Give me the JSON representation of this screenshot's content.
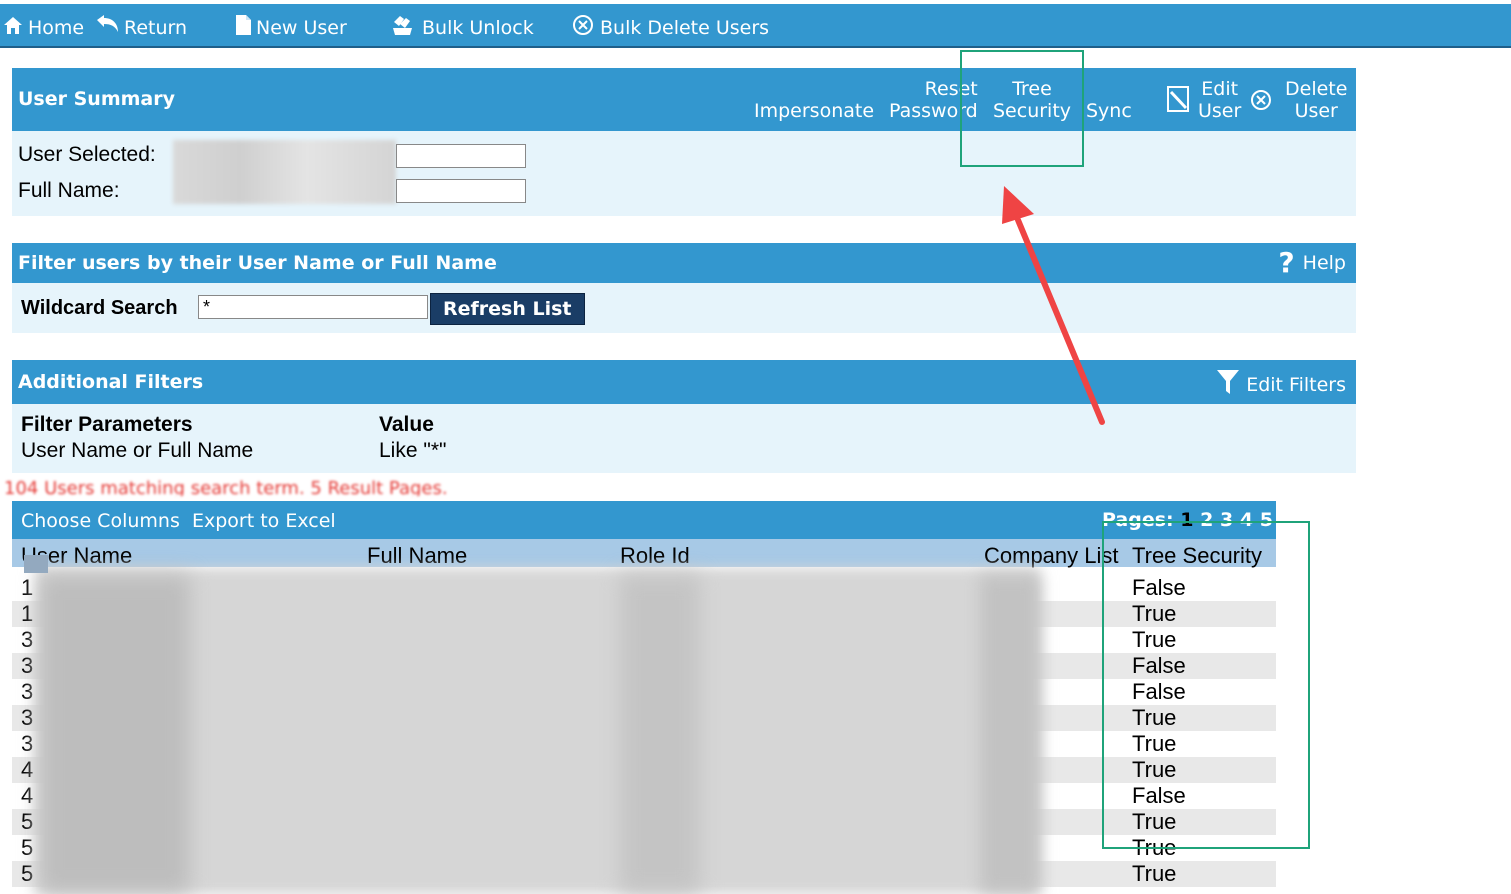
{
  "toolbar": {
    "home": "Home",
    "return": "Return",
    "new_user": "New User",
    "bulk_unlock": "Bulk Unlock",
    "bulk_delete": "Bulk Delete Users"
  },
  "user_summary": {
    "title": "User Summary",
    "actions": {
      "impersonate": "Impersonate",
      "reset_password_1": "Reset",
      "reset_password_2": "Password",
      "tree_security_1": "Tree",
      "tree_security_2": "Security",
      "sync": "Sync",
      "edit_user_1": "Edit",
      "edit_user_2": "User",
      "delete_user_1": "Delete",
      "delete_user_2": "User"
    },
    "user_selected_label": "User Selected:",
    "full_name_label": "Full Name:"
  },
  "filter": {
    "title": "Filter users by their User Name or Full Name",
    "help": "Help",
    "wildcard_label": "Wildcard Search",
    "wildcard_value": "*",
    "refresh": "Refresh List"
  },
  "additional_filters": {
    "title": "Additional Filters",
    "edit_filters": "Edit Filters",
    "col_param": "Filter Parameters",
    "col_value": "Value",
    "param": "User Name or Full Name",
    "value": "Like \"*\""
  },
  "results": {
    "count_text": "104 Users matching search term. 5 Result Pages.",
    "choose_columns": "Choose Columns",
    "export": "Export to Excel",
    "pages_label": "Pages:",
    "pages": [
      "1",
      "2",
      "3",
      "4",
      "5"
    ],
    "headers": {
      "user_name": "User Name",
      "full_name": "Full Name",
      "role_id": "Role Id",
      "company_list": "Company List",
      "tree_security": "Tree Security"
    },
    "rows": [
      {
        "uid": "1",
        "tree": "False"
      },
      {
        "uid": "1",
        "tree": "True"
      },
      {
        "uid": "3",
        "tree": "True"
      },
      {
        "uid": "3",
        "tree": "False"
      },
      {
        "uid": "3",
        "tree": "False"
      },
      {
        "uid": "3",
        "tree": "True"
      },
      {
        "uid": "3",
        "tree": "True"
      },
      {
        "uid": "4",
        "tree": "True"
      },
      {
        "uid": "4",
        "tree": "False"
      },
      {
        "uid": "5",
        "tree": "True"
      },
      {
        "uid": "5",
        "tree": "True"
      },
      {
        "uid": "5",
        "tree": "True"
      }
    ]
  },
  "colors": {
    "header_blue": "#3397cf",
    "panel_bg": "#e6f4fb",
    "button_navy": "#1a3d66",
    "highlight_green": "#1fa37a",
    "arrow_red": "#ef4444"
  }
}
